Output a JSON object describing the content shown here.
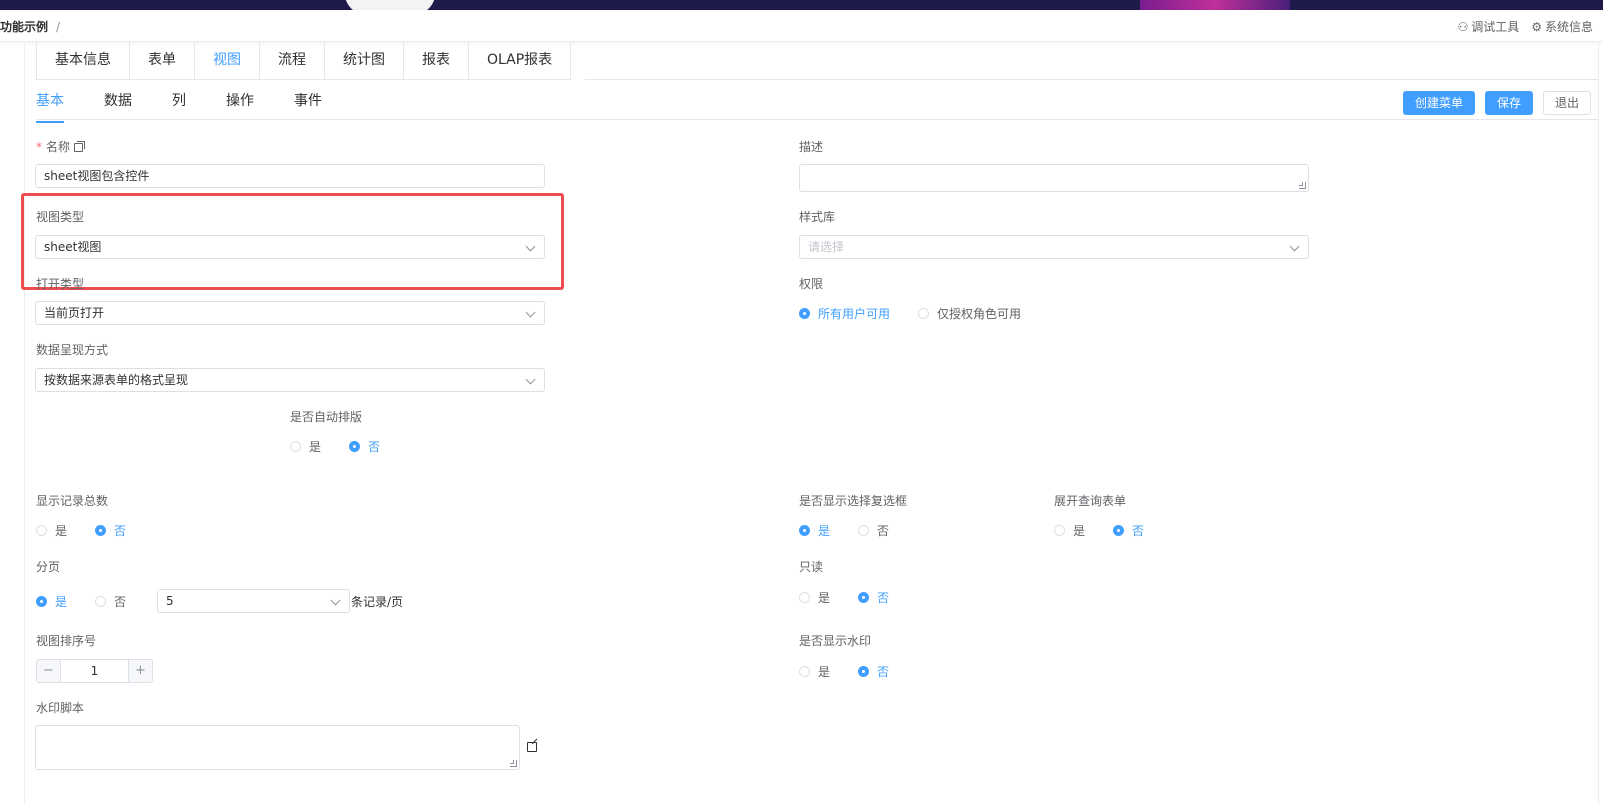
{
  "header": {
    "breadcrumb": "功能示例",
    "separator": "/",
    "tools": [
      {
        "icon": "bug-icon",
        "glyph": "⚇",
        "label": "调试工具"
      },
      {
        "icon": "gear-icon",
        "glyph": "⚙",
        "label": "系统信息"
      }
    ]
  },
  "main_tabs": [
    "基本信息",
    "表单",
    "视图",
    "流程",
    "统计图",
    "报表",
    "OLAP报表"
  ],
  "main_tab_active": "视图",
  "sub_tabs": [
    "基本",
    "数据",
    "列",
    "操作",
    "事件"
  ],
  "sub_tab_active": "基本",
  "actions": {
    "create_menu": "创建菜单",
    "save": "保存",
    "exit": "退出"
  },
  "form": {
    "name": {
      "label": "名称",
      "value": "sheet视图包含控件"
    },
    "description": {
      "label": "描述",
      "value": ""
    },
    "view_type": {
      "label": "视图类型",
      "value": "sheet视图"
    },
    "style_library": {
      "label": "样式库",
      "placeholder": "请选择"
    },
    "open_type": {
      "label": "打开类型",
      "value": "当前页打开"
    },
    "permission": {
      "label": "权限",
      "options": [
        "所有用户可用",
        "仅授权角色可用"
      ],
      "selected": "所有用户可用"
    },
    "display_mode": {
      "label": "数据呈现方式",
      "value": "按数据来源表单的格式呈现"
    },
    "auto_layout": {
      "label": "是否自动排版",
      "options": [
        "是",
        "否"
      ],
      "selected": "否"
    },
    "show_total": {
      "label": "显示记录总数",
      "options": [
        "是",
        "否"
      ],
      "selected": "否"
    },
    "show_checkbox": {
      "label": "是否显示选择复选框",
      "options": [
        "是",
        "否"
      ],
      "selected": "是"
    },
    "expand_query": {
      "label": "展开查询表单",
      "options": [
        "是",
        "否"
      ],
      "selected": "否"
    },
    "paging": {
      "label": "分页",
      "options": [
        "是",
        "否"
      ],
      "selected": "是",
      "page_size": "5",
      "suffix": "条记录/页"
    },
    "readonly": {
      "label": "只读",
      "options": [
        "是",
        "否"
      ],
      "selected": "否"
    },
    "sort_no": {
      "label": "视图排序号",
      "value": "1",
      "minus": "−",
      "plus": "+"
    },
    "show_watermark": {
      "label": "是否显示水印",
      "options": [
        "是",
        "否"
      ],
      "selected": "否"
    },
    "watermark_script": {
      "label": "水印脚本",
      "value": ""
    }
  },
  "colors": {
    "primary": "#409eff",
    "highlight": "#ee4d4f"
  }
}
